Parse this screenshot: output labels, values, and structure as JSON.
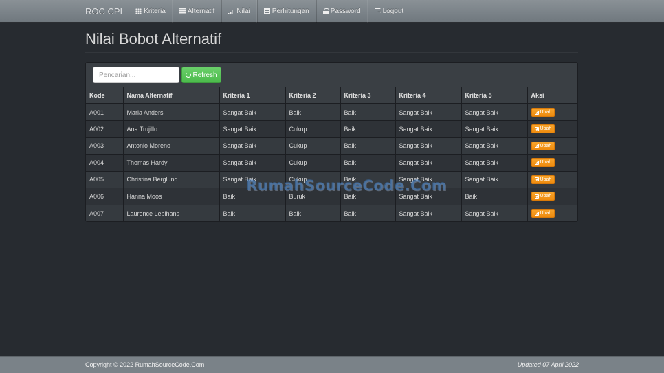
{
  "navbar": {
    "brand": "ROC CPI",
    "items": [
      {
        "label": "Kriteria",
        "icon": "grid-icon"
      },
      {
        "label": "Alternatif",
        "icon": "list-icon"
      },
      {
        "label": "Nilai",
        "icon": "bar-chart-icon"
      },
      {
        "label": "Perhitungan",
        "icon": "table-icon"
      },
      {
        "label": "Password",
        "icon": "lock-icon"
      },
      {
        "label": "Logout",
        "icon": "logout-icon"
      }
    ]
  },
  "page": {
    "title": "Nilai Bobot Alternatif"
  },
  "toolbar": {
    "search_placeholder": "Pencarian...",
    "refresh_label": "Refresh"
  },
  "table": {
    "headers": [
      "Kode",
      "Nama Alternatif",
      "Kriteria 1",
      "Kriteria 2",
      "Kriteria 3",
      "Kriteria 4",
      "Kriteria 5",
      "Aksi"
    ],
    "action_label": "Ubah",
    "rows": [
      [
        "A001",
        "Maria Anders",
        "Sangat Baik",
        "Baik",
        "Baik",
        "Sangat Baik",
        "Sangat Baik"
      ],
      [
        "A002",
        "Ana Trujillo",
        "Sangat Baik",
        "Cukup",
        "Baik",
        "Sangat Baik",
        "Sangat Baik"
      ],
      [
        "A003",
        "Antonio Moreno",
        "Sangat Baik",
        "Cukup",
        "Baik",
        "Sangat Baik",
        "Sangat Baik"
      ],
      [
        "A004",
        "Thomas Hardy",
        "Sangat Baik",
        "Cukup",
        "Baik",
        "Sangat Baik",
        "Sangat Baik"
      ],
      [
        "A005",
        "Christina Berglund",
        "Sangat Baik",
        "Cukup",
        "Baik",
        "Sangat Baik",
        "Sangat Baik"
      ],
      [
        "A006",
        "Hanna Moos",
        "Baik",
        "Buruk",
        "Baik",
        "Sangat Baik",
        "Baik"
      ],
      [
        "A007",
        "Laurence Lebihans",
        "Baik",
        "Baik",
        "Baik",
        "Sangat Baik",
        "Sangat Baik"
      ]
    ]
  },
  "watermark": "RumahSourceCode.Com",
  "footer": {
    "copyright": "Copyright © 2022 RumahSourceCode.Com",
    "updated": "Updated 07 April 2022"
  },
  "colors": {
    "background": "#272b30",
    "navbar": "#7a8288",
    "refresh_button": "#62c462",
    "ubah_button": "#f89406"
  }
}
